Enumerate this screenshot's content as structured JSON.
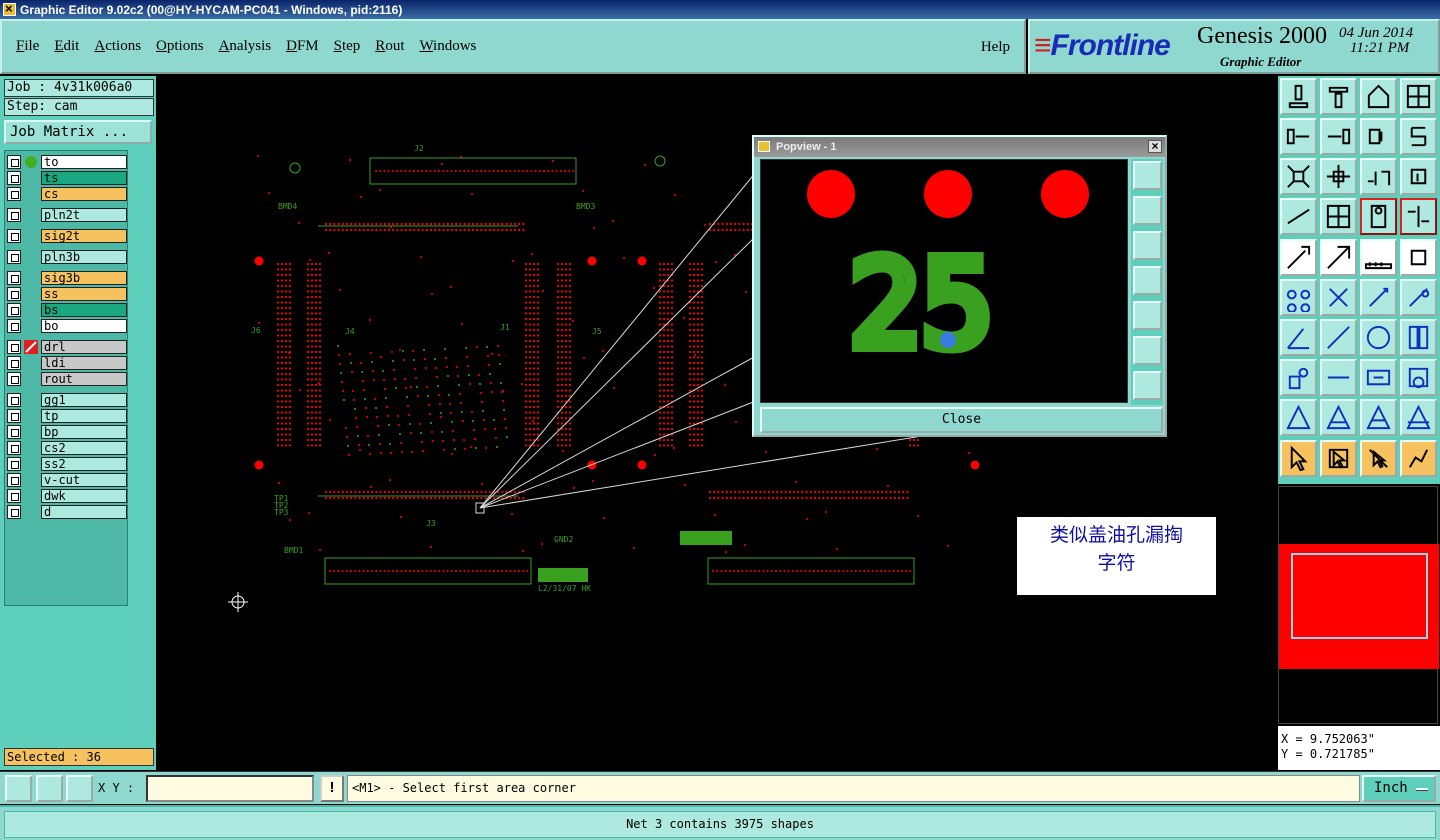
{
  "window": {
    "title": "Graphic Editor 9.02c2 (00@HY-HYCAM-PC041 - Windows, pid:2116)"
  },
  "menu": {
    "items": [
      "File",
      "Edit",
      "Actions",
      "Options",
      "Analysis",
      "DFM",
      "Step",
      "Rout",
      "Windows"
    ],
    "help": "Help"
  },
  "brand": {
    "logo": "Frontline",
    "product": "Genesis 2000",
    "subtitle": "Graphic Editor",
    "date": "04 Jun 2014",
    "time": "11:21 PM"
  },
  "job": {
    "job_label": "Job : 4v31k006a0",
    "step_label": "Step: cam",
    "matrix_button": "Job Matrix ..."
  },
  "layers": [
    {
      "name": "to",
      "color": "#ffffff",
      "indicator": "green-dot"
    },
    {
      "name": "ts",
      "color": "#1aa880"
    },
    {
      "name": "cs",
      "color": "#f6c260"
    },
    {
      "name": "pln2t",
      "color": "#aee9e0"
    },
    {
      "name": "sig2t",
      "color": "#f6c260"
    },
    {
      "name": "pln3b",
      "color": "#aee9e0"
    },
    {
      "name": "sig3b",
      "color": "#f6c260"
    },
    {
      "name": "ss",
      "color": "#f6c260"
    },
    {
      "name": "bs",
      "color": "#1aa880"
    },
    {
      "name": "bo",
      "color": "#ffffff"
    },
    {
      "name": "drl",
      "color": "#c8c8c8",
      "indicator": "drill-icon"
    },
    {
      "name": "ldi",
      "color": "#c8c8c8"
    },
    {
      "name": "rout",
      "color": "#c8c8c8"
    },
    {
      "name": "gg1",
      "color": "#aee9e0"
    },
    {
      "name": "tp",
      "color": "#aee9e0"
    },
    {
      "name": "bp",
      "color": "#aee9e0"
    },
    {
      "name": "cs2",
      "color": "#aee9e0"
    },
    {
      "name": "ss2",
      "color": "#aee9e0"
    },
    {
      "name": "v-cut",
      "color": "#aee9e0"
    },
    {
      "name": "dwk",
      "color": "#aee9e0"
    },
    {
      "name": "d",
      "color": "#aee9e0"
    }
  ],
  "selected": "Selected : 36",
  "popview": {
    "title": "Popview - 1",
    "close_label": "Close",
    "zoom_text": "25"
  },
  "board_labels": {
    "j2": "J2",
    "j1": "J1",
    "j4": "J4",
    "j3": "J3",
    "j5": "J5",
    "j6": "J6",
    "date_code": "L2/31/07 HK",
    "tp1": "TP1",
    "tp2": "TP2",
    "tp3": "TP3",
    "bmd4": "BMD4",
    "bmd3": "BMD3",
    "bmd1": "BMD1",
    "gnd2": "GND2"
  },
  "note": {
    "text": "类似盖油孔漏掏字符"
  },
  "coords": {
    "x": "X = 9.752063\"",
    "y": "Y = 0.721785\""
  },
  "bottom": {
    "xy_label": "X Y :",
    "xy_value": "",
    "excl": "!",
    "prompt": "<M1> - Select first area corner",
    "units": "Inch"
  },
  "status": {
    "message": "Net 3 contains 3975 shapes"
  },
  "colors": {
    "panel": "#8fd8d0",
    "board_green": "#3aa020",
    "pad_red": "#ff0000"
  }
}
